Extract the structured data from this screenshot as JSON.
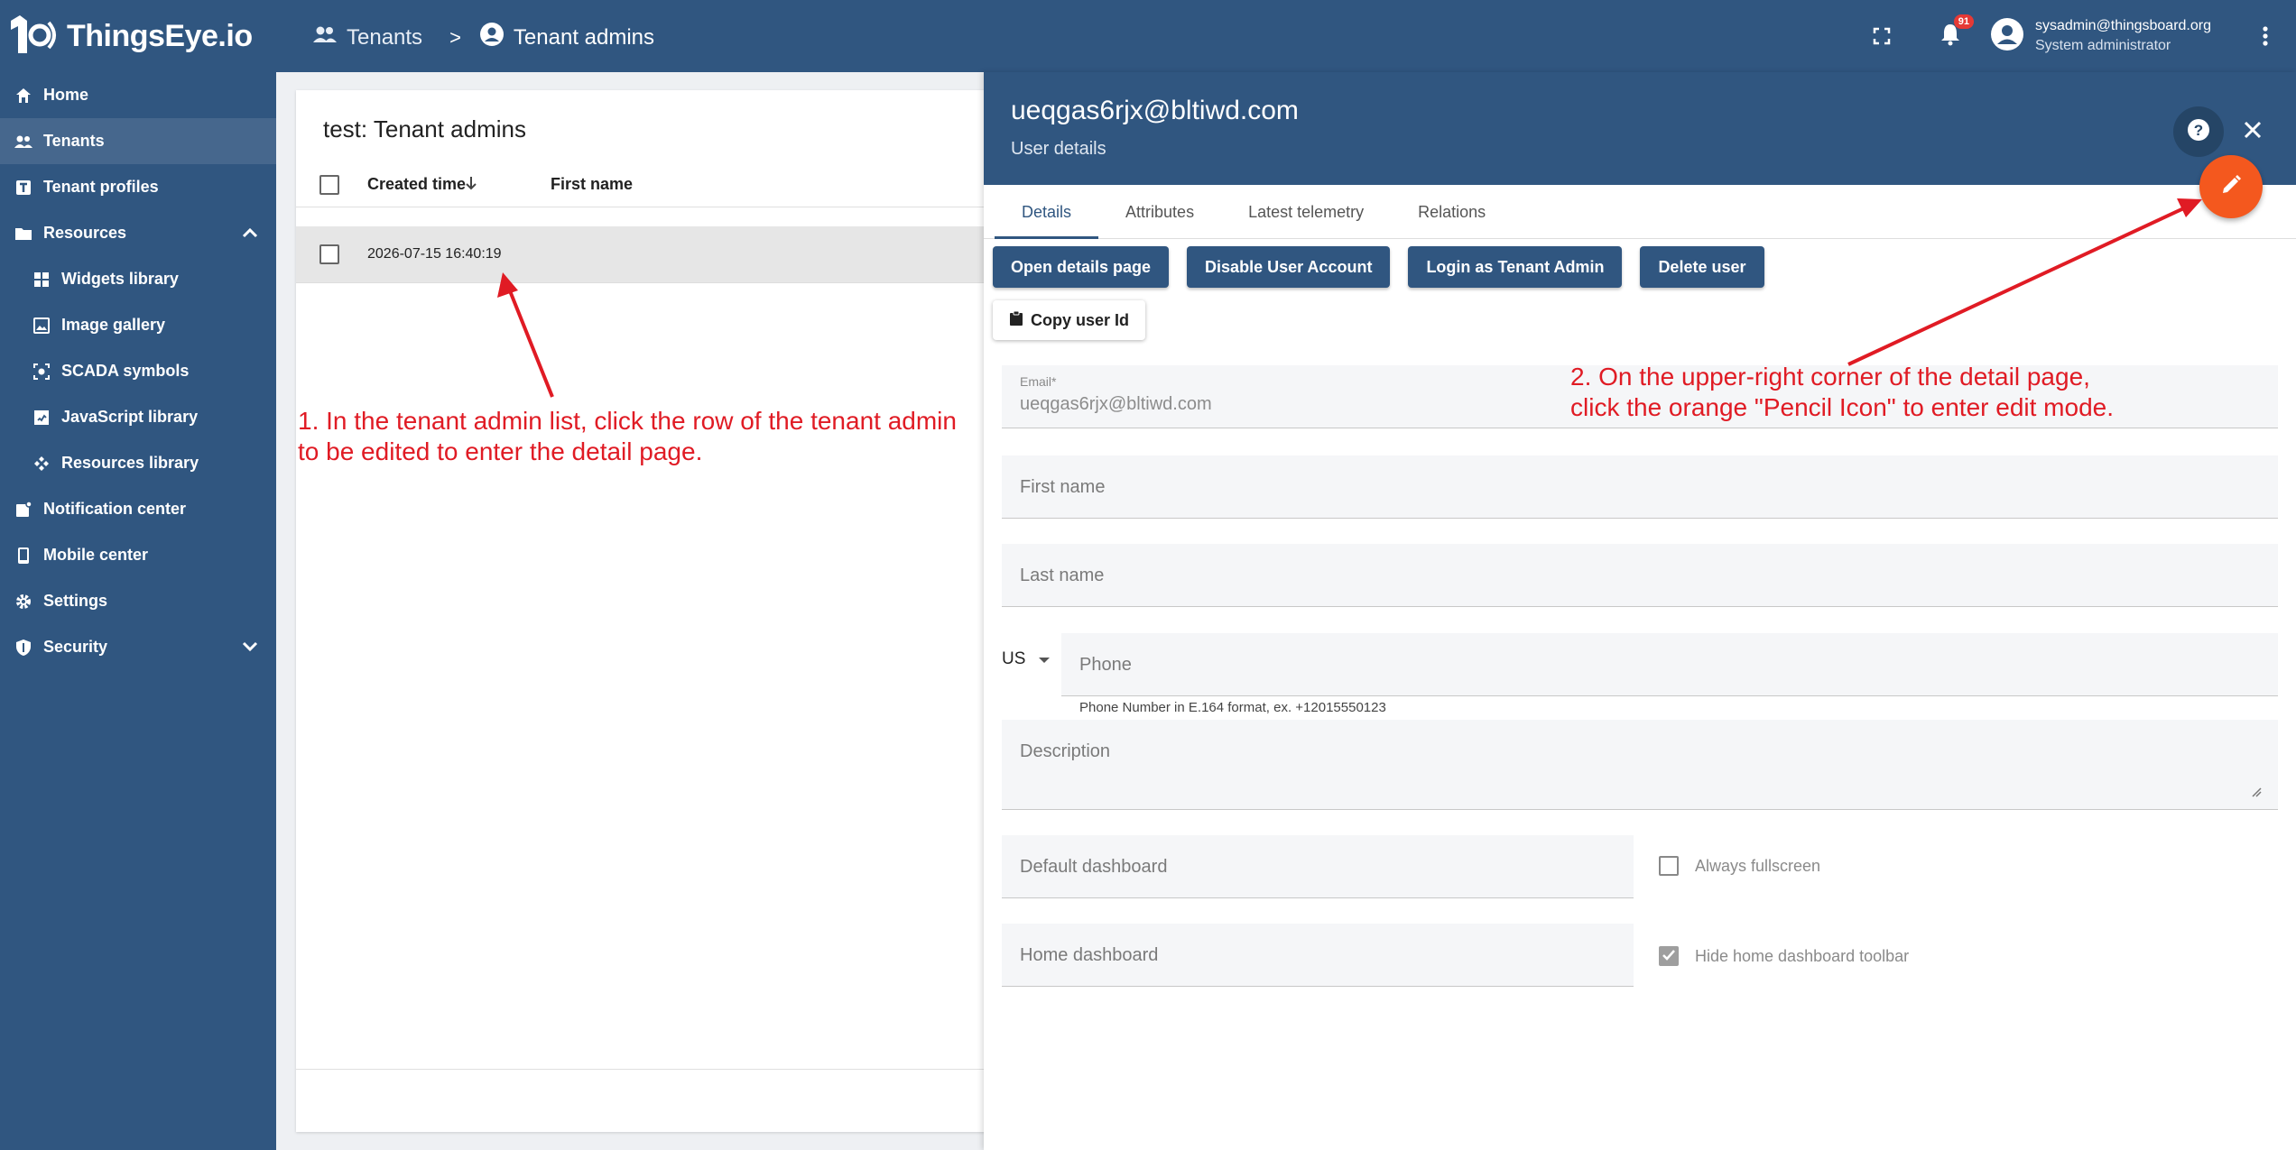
{
  "brand": {
    "name": "ThingsEye.io"
  },
  "breadcrumb": {
    "items": [
      "Tenants",
      "Tenant admins"
    ],
    "separator": ">"
  },
  "topbar": {
    "notification_count": "91",
    "user_email": "sysadmin@thingsboard.org",
    "user_role": "System administrator"
  },
  "sidebar": {
    "items": [
      {
        "label": "Home",
        "icon": "home-icon"
      },
      {
        "label": "Tenants",
        "icon": "tenants-icon",
        "active": true
      },
      {
        "label": "Tenant profiles",
        "icon": "tenant-profiles-icon"
      },
      {
        "label": "Resources",
        "icon": "folder-icon",
        "expanded": true
      },
      {
        "label": "Widgets library",
        "icon": "widgets-icon"
      },
      {
        "label": "Image gallery",
        "icon": "image-icon"
      },
      {
        "label": "SCADA symbols",
        "icon": "scada-icon"
      },
      {
        "label": "JavaScript library",
        "icon": "javascript-icon"
      },
      {
        "label": "Resources library",
        "icon": "resources-icon"
      },
      {
        "label": "Notification center",
        "icon": "notification-center-icon"
      },
      {
        "label": "Mobile center",
        "icon": "mobile-icon"
      },
      {
        "label": "Settings",
        "icon": "gear-icon"
      },
      {
        "label": "Security",
        "icon": "shield-icon"
      }
    ]
  },
  "list": {
    "title": "test: Tenant admins",
    "columns": [
      "Created time",
      "First name"
    ],
    "rows": [
      {
        "created": "2026-07-15 16:40:19"
      }
    ]
  },
  "detail": {
    "title": "ueqgas6rjx@bltiwd.com",
    "subtitle": "User details",
    "tabs": [
      "Details",
      "Attributes",
      "Latest telemetry",
      "Relations"
    ],
    "buttons": [
      "Open details page",
      "Disable User Account",
      "Login as Tenant Admin",
      "Delete user"
    ],
    "copy_label": "Copy user Id",
    "email_label": "Email*",
    "email_value": "ueqgas6rjx@bltiwd.com",
    "first_name": "First name",
    "last_name": "Last name",
    "country": "US",
    "phone": "Phone",
    "phone_hint": "Phone Number in E.164 format, ex. +12015550123",
    "description": "Description",
    "default_dashboard": "Default dashboard",
    "always_fullscreen": "Always fullscreen",
    "home_dashboard": "Home dashboard",
    "hide_toolbar": "Hide home dashboard toolbar",
    "hide_toolbar_checked": true
  },
  "annotations": {
    "step1_line1": "1. In the tenant admin list, click the row of the tenant admin",
    "step1_line2": "to be edited to enter the detail page.",
    "step2_line1": "2. On the upper-right corner of the detail page,",
    "step2_line2": "click the orange \"Pencil Icon\" to enter edit mode."
  },
  "colors": {
    "primary": "#305680",
    "fab": "#f4581e",
    "annotation": "#e01b24"
  }
}
